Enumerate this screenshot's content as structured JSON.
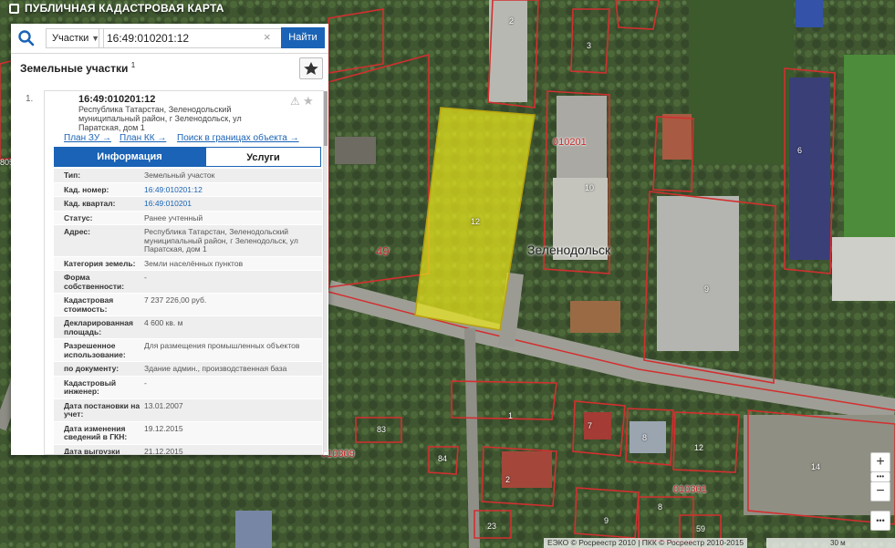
{
  "app": {
    "title": "ПУБЛИЧНАЯ КАДАСТРОВАЯ КАРТА"
  },
  "search": {
    "category": "Участки",
    "query": "16:49:010201:12",
    "find_label": "Найти",
    "search_icon": "search-icon",
    "clear_icon": "close-icon"
  },
  "results": {
    "title": "Земельные участки",
    "count": "1",
    "star_icon": "star-icon"
  },
  "item": {
    "index": "1.",
    "cad_number": "16:49:010201:12",
    "address": "Республика Татарстан, Зеленодольский муниципальный район, г Зеленодольск, ул Паратская, дом 1",
    "links": [
      "План ЗУ →",
      "План КК →",
      "Поиск в границах объекта →"
    ],
    "tabs": [
      "Информация",
      "Услуги"
    ],
    "active_tab": "Информация",
    "rows": [
      {
        "k": "Тип:",
        "v": "Земельный участок",
        "link": false
      },
      {
        "k": "Кад. номер:",
        "v": "16:49:010201:12",
        "link": true
      },
      {
        "k": "Кад. квартал:",
        "v": "16:49:010201",
        "link": true
      },
      {
        "k": "Статус:",
        "v": "Ранее учтенный",
        "link": false
      },
      {
        "k": "Адрес:",
        "v": "Республика Татарстан, Зеленодольский муниципальный район, г Зеленодольск, ул Паратская, дом 1",
        "link": false
      },
      {
        "k": "Категория земель:",
        "v": "Земли населённых пунктов",
        "link": false
      },
      {
        "k": "Форма собственности:",
        "v": "-",
        "link": false
      },
      {
        "k": "Кадастровая стоимость:",
        "v": "7 237 226,00 руб.",
        "link": false
      },
      {
        "k": "Декларированная площадь:",
        "v": "4 600 кв. м",
        "link": false
      },
      {
        "k": "Разрешенное использование:",
        "v": "Для размещения промышленных объектов",
        "link": false
      },
      {
        "k": "по документу:",
        "v": "Здание админ., производственная база",
        "link": false
      },
      {
        "k": "Кадастровый инженер:",
        "v": "-",
        "link": false
      },
      {
        "k": "Дата постановки на учет:",
        "v": "13.01.2007",
        "link": false
      },
      {
        "k": "Дата изменения сведений в ГКН:",
        "v": "19.12.2015",
        "link": false
      },
      {
        "k": "Дата выгрузки сведений из ГКН:",
        "v": "21.12.2015",
        "link": false
      }
    ]
  },
  "map": {
    "town": "Зеленодольск",
    "quarter_labels": [
      "010201",
      "010301",
      "010309"
    ],
    "parcel_labels": [
      {
        "t": "2"
      },
      {
        "t": "3"
      },
      {
        "t": "10"
      },
      {
        "t": "12"
      },
      {
        "t": "49"
      },
      {
        "t": "6"
      },
      {
        "t": "9"
      },
      {
        "t": "1"
      },
      {
        "t": "7"
      },
      {
        "t": "8"
      },
      {
        "t": "12"
      },
      {
        "t": "14"
      },
      {
        "t": "83"
      },
      {
        "t": "84"
      },
      {
        "t": "2"
      },
      {
        "t": "23"
      },
      {
        "t": "9"
      },
      {
        "t": "8"
      },
      {
        "t": "59"
      },
      {
        "t": "805"
      }
    ],
    "credits": "ЕЭКО © Росреестр 2010 | ПКК © Росреестр 2010-2015",
    "scale": "30 м",
    "zoom_in": "+",
    "zoom_out": "−",
    "more": "•••"
  },
  "colors": {
    "accent": "#1a63b6",
    "parcel_highlight": "#e8e51a",
    "boundary": "#d32f2f"
  }
}
